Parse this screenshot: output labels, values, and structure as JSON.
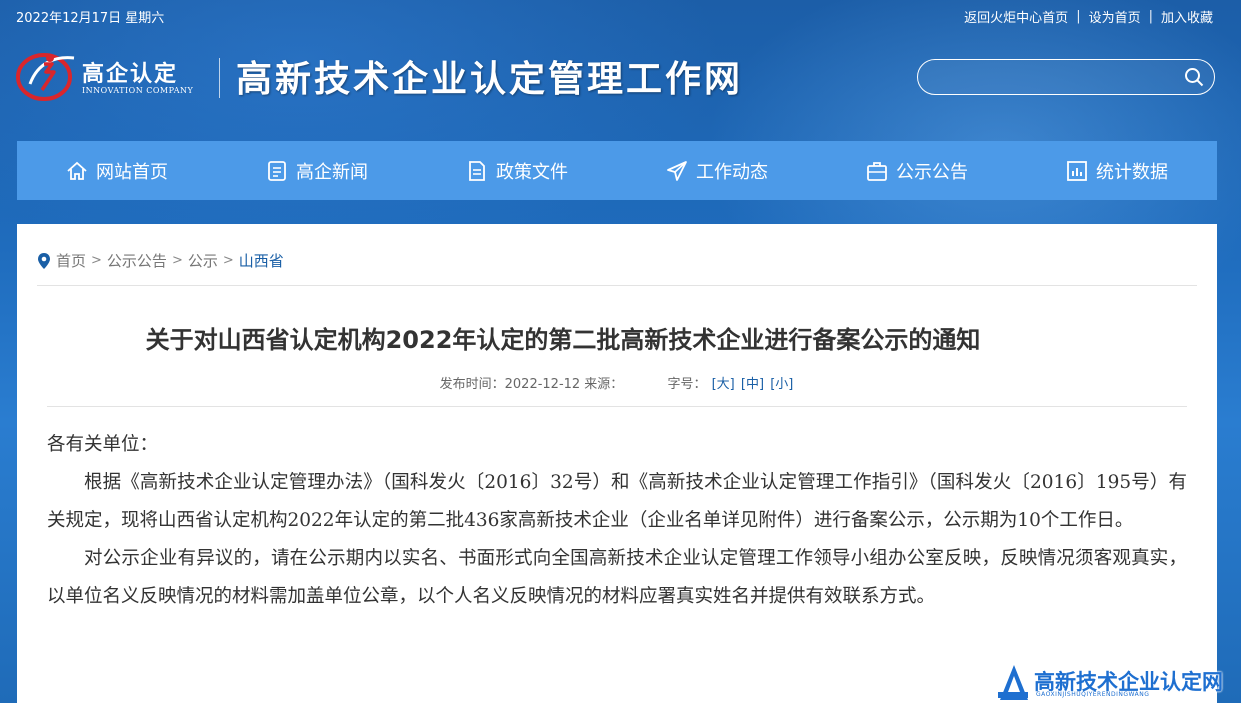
{
  "topbar": {
    "date": "2022年12月17日 星期六",
    "links": [
      "返回火炬中心首页",
      "设为首页",
      "加入收藏"
    ]
  },
  "logo": {
    "cn": "高企认定",
    "en": "INNOVATION COMPANY"
  },
  "site_title": "高新技术企业认定管理工作网",
  "search": {
    "placeholder": ""
  },
  "nav": [
    {
      "label": "网站首页",
      "icon": "home-icon"
    },
    {
      "label": "高企新闻",
      "icon": "news-icon"
    },
    {
      "label": "政策文件",
      "icon": "document-icon"
    },
    {
      "label": "工作动态",
      "icon": "paper-plane-icon"
    },
    {
      "label": "公示公告",
      "icon": "briefcase-icon"
    },
    {
      "label": "统计数据",
      "icon": "chart-icon"
    }
  ],
  "breadcrumb": [
    "首页",
    "公示公告",
    "公示",
    "山西省"
  ],
  "article": {
    "title": "关于对山西省认定机构2022年认定的第二批高新技术企业进行备案公示的通知",
    "meta_published": "发布时间：2022-12-12 来源：",
    "meta_fontsize_label": "字号：",
    "font_large": "[大]",
    "font_medium": "[中]",
    "font_small": "[小]",
    "paragraphs": [
      "各有关单位：",
      "根据《高新技术企业认定管理办法》（国科发火〔2016〕32号）和《高新技术企业认定管理工作指引》（国科发火〔2016〕195号）有关规定，现将山西省认定机构2022年认定的第二批436家高新技术企业（企业名单详见附件）进行备案公示，公示期为10个工作日。",
      "对公示企业有异议的，请在公示期内以实名、书面形式向全国高新技术企业认定管理工作领导小组办公室反映，反映情况须客观真实，以单位名义反映情况的材料需加盖单位公章，以个人名义反映情况的材料应署真实姓名并提供有效联系方式。"
    ]
  },
  "watermark": {
    "cn": "高新技术企业认定网",
    "en": "GAOXINJISHUQIYERENDINGWANG"
  },
  "colors": {
    "header_bg": "#1f6cbd",
    "nav_bg": "#4c9ae8",
    "link_blue": "#1a5fa6",
    "logo_red": "#d9262c"
  }
}
